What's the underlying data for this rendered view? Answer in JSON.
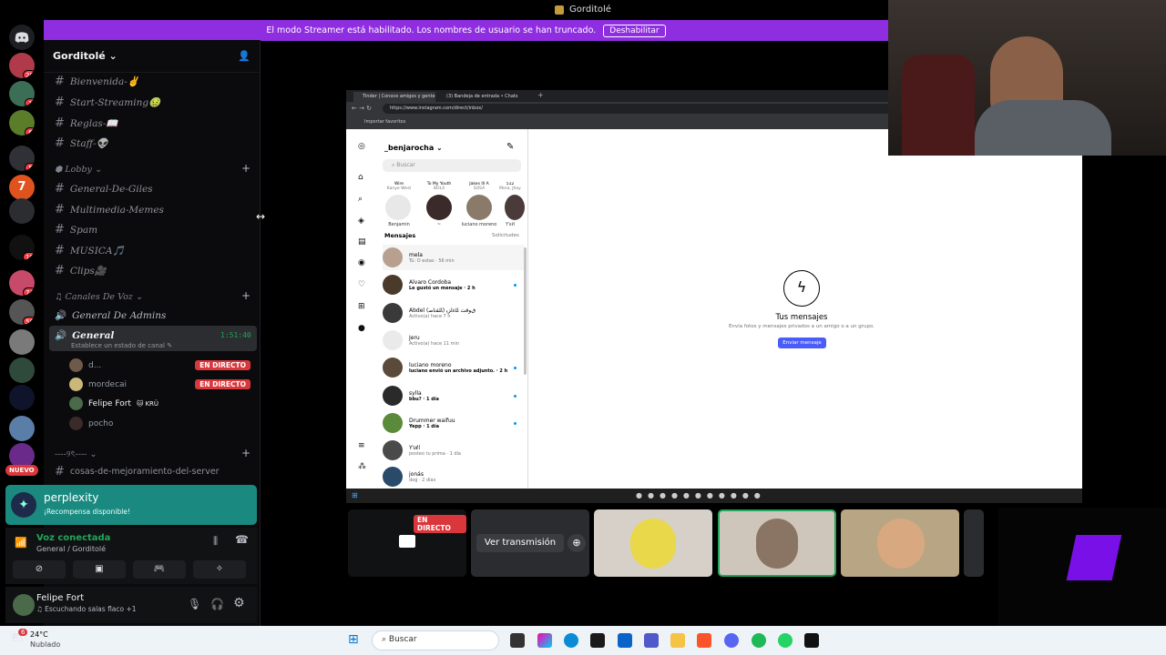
{
  "window": {
    "title": "Gorditolé"
  },
  "banner": {
    "text": "El modo Streamer está habilitado. Los nombres de usuario se han truncado.",
    "button": "Deshabilitar"
  },
  "server_rail": {
    "badges": [
      "29",
      "1",
      "6",
      "5",
      "19",
      "74",
      "56",
      "NUEVO"
    ]
  },
  "guild": {
    "name": "Gorditolé"
  },
  "channels": [
    {
      "name": "Bienvenida-✌️"
    },
    {
      "name": "Start-Streaming🤢"
    },
    {
      "name": "Reglas-📖"
    },
    {
      "name": "Staff-👽"
    }
  ],
  "category_lobby": "Lobby",
  "lobby_channels": [
    {
      "name": "General-De-Giles"
    },
    {
      "name": "Multimedia-Memes"
    },
    {
      "name": "Spam"
    },
    {
      "name": "MUSICA🎵"
    },
    {
      "name": "Clips🎥"
    }
  ],
  "category_voice": "Canales De Voz",
  "voice_channels": {
    "admins": "General De Admins",
    "general": "General",
    "general_time": "1:51:40",
    "status_hint": "Establece un estado de canal",
    "users": [
      {
        "name": "d...",
        "live": "EN DIRECTO"
      },
      {
        "name": "mordecai",
        "live": "EN DIRECTO"
      },
      {
        "name": "Felipe Fort",
        "tag": "KRÜ"
      },
      {
        "name": "pocho"
      }
    ]
  },
  "category_misc": "----୨ৎ----",
  "misc_channel": "cosas-de-mejoramiento-del-server",
  "perplexity": {
    "title": "perplexity",
    "subtitle": "¡Recompensa disponible!"
  },
  "voice_panel": {
    "status": "Voz conectada",
    "where": "General / Gorditolé"
  },
  "user": {
    "name": "Felipe Fort",
    "activity": "Escuchando salas flaco +1"
  },
  "browser": {
    "tab1": "Tinder | Conoce amigos y gente",
    "tab2": "(3) Bandeja de entrada • Chats",
    "url": "https://www.instagram.com/direct/inbox/",
    "bookmark": "Importar favoritos"
  },
  "instagram": {
    "username": "_benjarocha",
    "search_placeholder": "Buscar",
    "notes": [
      {
        "note": "Wire",
        "sub": "Kanye West",
        "name": "Benjamin"
      },
      {
        "note": "To My Youth",
        "sub": "BOL4",
        "name": "~"
      },
      {
        "note": "Jakes Ill A",
        "sub": "SOSA",
        "name": "luciano moreno"
      },
      {
        "note": "512",
        "sub": "Mora, Jhay",
        "name": "Ƴυℓí"
      }
    ],
    "messages_label": "Mensajes",
    "requests_label": "Solicitudes",
    "dms": [
      {
        "name": "mela",
        "preview": "Tú: O estas · 56 min",
        "unread": false
      },
      {
        "name": "Alvaro Cordoba",
        "preview": "Le gustó un mensaje · 2 h",
        "unread": true
      },
      {
        "name": "Abdel (ﺎﻠﻘﻧﺎﺻ) ﻕﻮﻗﺖ ﺎﻠﻏﺍﺰﻳ",
        "preview": "Activo(a) hace 7 h",
        "unread": false
      },
      {
        "name": "Jeru",
        "preview": "Activo(a) hace 11 min",
        "unread": false
      },
      {
        "name": "luciano moreno",
        "preview": "luciano envió un archivo adjunto. · 2 h",
        "unread": true
      },
      {
        "name": "sylla",
        "preview": "bbu? · 1 día",
        "unread": true
      },
      {
        "name": "Drummer waifuu",
        "preview": "Yepp · 1 día",
        "unread": true
      },
      {
        "name": "Ƴυℓí",
        "preview": "posteo tu prima · 1 día",
        "unread": false
      },
      {
        "name": "jonás",
        "preview": "dog · 2 días",
        "unread": false
      }
    ],
    "empty_title": "Tus mensajes",
    "empty_sub": "Envía fotos y mensajes privados a un amigo o a un grupo.",
    "send_button": "Enviar mensaje"
  },
  "stream_tiles": {
    "live": "EN DIRECTO",
    "watch": "Ver transmisión"
  },
  "taskbar": {
    "temp": "24°C",
    "weather": "Nublado",
    "search": "Buscar",
    "notif_count": "6"
  },
  "colors": {
    "banner": "#8f2de0",
    "perplexity": "#1a8a80",
    "live": "#da373c",
    "voice_green": "#23a55a"
  }
}
